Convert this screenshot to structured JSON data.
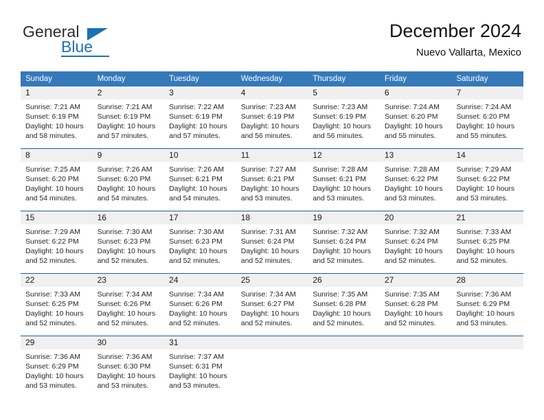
{
  "logo": {
    "word1": "General",
    "word2": "Blue",
    "icon": "triangle-mark"
  },
  "header": {
    "title": "December 2024",
    "subtitle": "Nuevo Vallarta, Mexico"
  },
  "colors": {
    "header_blue": "#3579bb",
    "rule_blue": "#1b5fa3",
    "daynum_strip": "#f0f0f0",
    "logo_blue": "#1b72b8"
  },
  "weekdays": [
    "Sunday",
    "Monday",
    "Tuesday",
    "Wednesday",
    "Thursday",
    "Friday",
    "Saturday"
  ],
  "weeks": [
    [
      {
        "day": "1",
        "sunrise": "Sunrise: 7:21 AM",
        "sunset": "Sunset: 6:19 PM",
        "daylight1": "Daylight: 10 hours",
        "daylight2": "and 58 minutes."
      },
      {
        "day": "2",
        "sunrise": "Sunrise: 7:21 AM",
        "sunset": "Sunset: 6:19 PM",
        "daylight1": "Daylight: 10 hours",
        "daylight2": "and 57 minutes."
      },
      {
        "day": "3",
        "sunrise": "Sunrise: 7:22 AM",
        "sunset": "Sunset: 6:19 PM",
        "daylight1": "Daylight: 10 hours",
        "daylight2": "and 57 minutes."
      },
      {
        "day": "4",
        "sunrise": "Sunrise: 7:23 AM",
        "sunset": "Sunset: 6:19 PM",
        "daylight1": "Daylight: 10 hours",
        "daylight2": "and 56 minutes."
      },
      {
        "day": "5",
        "sunrise": "Sunrise: 7:23 AM",
        "sunset": "Sunset: 6:19 PM",
        "daylight1": "Daylight: 10 hours",
        "daylight2": "and 56 minutes."
      },
      {
        "day": "6",
        "sunrise": "Sunrise: 7:24 AM",
        "sunset": "Sunset: 6:20 PM",
        "daylight1": "Daylight: 10 hours",
        "daylight2": "and 55 minutes."
      },
      {
        "day": "7",
        "sunrise": "Sunrise: 7:24 AM",
        "sunset": "Sunset: 6:20 PM",
        "daylight1": "Daylight: 10 hours",
        "daylight2": "and 55 minutes."
      }
    ],
    [
      {
        "day": "8",
        "sunrise": "Sunrise: 7:25 AM",
        "sunset": "Sunset: 6:20 PM",
        "daylight1": "Daylight: 10 hours",
        "daylight2": "and 54 minutes."
      },
      {
        "day": "9",
        "sunrise": "Sunrise: 7:26 AM",
        "sunset": "Sunset: 6:20 PM",
        "daylight1": "Daylight: 10 hours",
        "daylight2": "and 54 minutes."
      },
      {
        "day": "10",
        "sunrise": "Sunrise: 7:26 AM",
        "sunset": "Sunset: 6:21 PM",
        "daylight1": "Daylight: 10 hours",
        "daylight2": "and 54 minutes."
      },
      {
        "day": "11",
        "sunrise": "Sunrise: 7:27 AM",
        "sunset": "Sunset: 6:21 PM",
        "daylight1": "Daylight: 10 hours",
        "daylight2": "and 53 minutes."
      },
      {
        "day": "12",
        "sunrise": "Sunrise: 7:28 AM",
        "sunset": "Sunset: 6:21 PM",
        "daylight1": "Daylight: 10 hours",
        "daylight2": "and 53 minutes."
      },
      {
        "day": "13",
        "sunrise": "Sunrise: 7:28 AM",
        "sunset": "Sunset: 6:22 PM",
        "daylight1": "Daylight: 10 hours",
        "daylight2": "and 53 minutes."
      },
      {
        "day": "14",
        "sunrise": "Sunrise: 7:29 AM",
        "sunset": "Sunset: 6:22 PM",
        "daylight1": "Daylight: 10 hours",
        "daylight2": "and 53 minutes."
      }
    ],
    [
      {
        "day": "15",
        "sunrise": "Sunrise: 7:29 AM",
        "sunset": "Sunset: 6:22 PM",
        "daylight1": "Daylight: 10 hours",
        "daylight2": "and 52 minutes."
      },
      {
        "day": "16",
        "sunrise": "Sunrise: 7:30 AM",
        "sunset": "Sunset: 6:23 PM",
        "daylight1": "Daylight: 10 hours",
        "daylight2": "and 52 minutes."
      },
      {
        "day": "17",
        "sunrise": "Sunrise: 7:30 AM",
        "sunset": "Sunset: 6:23 PM",
        "daylight1": "Daylight: 10 hours",
        "daylight2": "and 52 minutes."
      },
      {
        "day": "18",
        "sunrise": "Sunrise: 7:31 AM",
        "sunset": "Sunset: 6:24 PM",
        "daylight1": "Daylight: 10 hours",
        "daylight2": "and 52 minutes."
      },
      {
        "day": "19",
        "sunrise": "Sunrise: 7:32 AM",
        "sunset": "Sunset: 6:24 PM",
        "daylight1": "Daylight: 10 hours",
        "daylight2": "and 52 minutes."
      },
      {
        "day": "20",
        "sunrise": "Sunrise: 7:32 AM",
        "sunset": "Sunset: 6:24 PM",
        "daylight1": "Daylight: 10 hours",
        "daylight2": "and 52 minutes."
      },
      {
        "day": "21",
        "sunrise": "Sunrise: 7:33 AM",
        "sunset": "Sunset: 6:25 PM",
        "daylight1": "Daylight: 10 hours",
        "daylight2": "and 52 minutes."
      }
    ],
    [
      {
        "day": "22",
        "sunrise": "Sunrise: 7:33 AM",
        "sunset": "Sunset: 6:25 PM",
        "daylight1": "Daylight: 10 hours",
        "daylight2": "and 52 minutes."
      },
      {
        "day": "23",
        "sunrise": "Sunrise: 7:34 AM",
        "sunset": "Sunset: 6:26 PM",
        "daylight1": "Daylight: 10 hours",
        "daylight2": "and 52 minutes."
      },
      {
        "day": "24",
        "sunrise": "Sunrise: 7:34 AM",
        "sunset": "Sunset: 6:26 PM",
        "daylight1": "Daylight: 10 hours",
        "daylight2": "and 52 minutes."
      },
      {
        "day": "25",
        "sunrise": "Sunrise: 7:34 AM",
        "sunset": "Sunset: 6:27 PM",
        "daylight1": "Daylight: 10 hours",
        "daylight2": "and 52 minutes."
      },
      {
        "day": "26",
        "sunrise": "Sunrise: 7:35 AM",
        "sunset": "Sunset: 6:28 PM",
        "daylight1": "Daylight: 10 hours",
        "daylight2": "and 52 minutes."
      },
      {
        "day": "27",
        "sunrise": "Sunrise: 7:35 AM",
        "sunset": "Sunset: 6:28 PM",
        "daylight1": "Daylight: 10 hours",
        "daylight2": "and 52 minutes."
      },
      {
        "day": "28",
        "sunrise": "Sunrise: 7:36 AM",
        "sunset": "Sunset: 6:29 PM",
        "daylight1": "Daylight: 10 hours",
        "daylight2": "and 53 minutes."
      }
    ],
    [
      {
        "day": "29",
        "sunrise": "Sunrise: 7:36 AM",
        "sunset": "Sunset: 6:29 PM",
        "daylight1": "Daylight: 10 hours",
        "daylight2": "and 53 minutes."
      },
      {
        "day": "30",
        "sunrise": "Sunrise: 7:36 AM",
        "sunset": "Sunset: 6:30 PM",
        "daylight1": "Daylight: 10 hours",
        "daylight2": "and 53 minutes."
      },
      {
        "day": "31",
        "sunrise": "Sunrise: 7:37 AM",
        "sunset": "Sunset: 6:31 PM",
        "daylight1": "Daylight: 10 hours",
        "daylight2": "and 53 minutes."
      },
      {
        "day": "",
        "sunrise": "",
        "sunset": "",
        "daylight1": "",
        "daylight2": ""
      },
      {
        "day": "",
        "sunrise": "",
        "sunset": "",
        "daylight1": "",
        "daylight2": ""
      },
      {
        "day": "",
        "sunrise": "",
        "sunset": "",
        "daylight1": "",
        "daylight2": ""
      },
      {
        "day": "",
        "sunrise": "",
        "sunset": "",
        "daylight1": "",
        "daylight2": ""
      }
    ]
  ]
}
